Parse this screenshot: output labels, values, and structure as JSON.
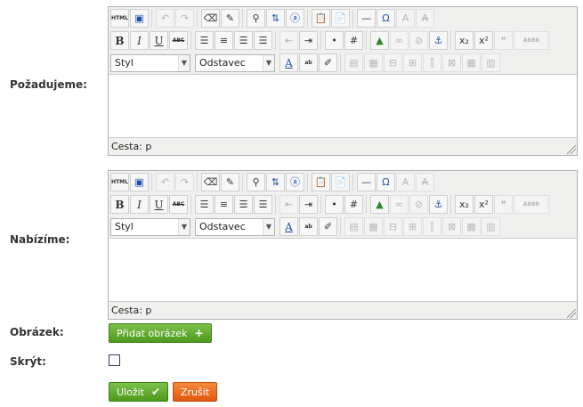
{
  "form": {
    "field_pozadujeme": "Požadujeme:",
    "field_nabizime": "Nabízíme:",
    "field_obrazek": "Obrázek:",
    "field_skryt": "Skrýt:"
  },
  "editor": {
    "style_select": "Styl",
    "format_select": "Odstavec",
    "status_prefix": "Cesta: p",
    "toolbar": {
      "html": "HTML",
      "bold": "B",
      "italic": "I",
      "underline": "U",
      "strike": "ABC",
      "subscript": "x₂",
      "superscript": "x²",
      "omega": "Ω",
      "text_color": "A",
      "bg_color": "ab"
    }
  },
  "buttons": {
    "add_image": "Přidat obrázek",
    "save": "Uložit",
    "cancel": "Zrušit"
  },
  "colors": {
    "green_button": "#5aa82a",
    "orange_button": "#e8621a",
    "editor_bg": "#f0f0ee"
  }
}
